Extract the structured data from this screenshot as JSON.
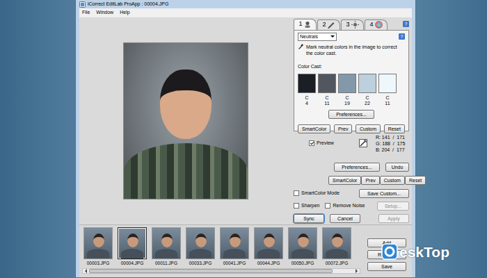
{
  "window": {
    "title": "iCorrect EditLab ProApp : 00004.JPG"
  },
  "menu": [
    {
      "label": "File"
    },
    {
      "label": "Window"
    },
    {
      "label": "Help"
    }
  ],
  "tabs": [
    {
      "label": "1",
      "selected": true
    },
    {
      "label": "2",
      "selected": false
    },
    {
      "label": "3",
      "selected": false
    },
    {
      "label": "4",
      "selected": false
    }
  ],
  "help_button": "?",
  "panel": {
    "mode": "Neutrals",
    "help": "?",
    "instruction": "Mark neutral colors in the image to correct the color cast.",
    "swatch_title": "Color Cast:",
    "swatches": [
      {
        "letter": "C",
        "value": "4",
        "color": "#1c1e26"
      },
      {
        "letter": "C",
        "value": "11",
        "color": "#52575f"
      },
      {
        "letter": "C",
        "value": "19",
        "color": "#8398a8"
      },
      {
        "letter": "C",
        "value": "22",
        "color": "#bcd0de"
      },
      {
        "letter": "C",
        "value": "11",
        "color": "#eef7fc"
      }
    ],
    "preferences": "Preferences...",
    "buttons": [
      "SmartColor",
      "Prev",
      "Custom",
      "Reset"
    ]
  },
  "preview": {
    "label": "Preview",
    "checked": true
  },
  "readings": [
    {
      "channel": "R:",
      "value": "141  /  171"
    },
    {
      "channel": "G:",
      "value": "188  /  175"
    },
    {
      "channel": "B:",
      "value": "204  /  177"
    }
  ],
  "preferences_button": "Preferences...",
  "undo_button": "Undo",
  "tool_buttons": [
    "SmartColor",
    "Prev",
    "Custom",
    "Reset"
  ],
  "smartcolor_mode": {
    "label": "SmartColor Mode",
    "checked": false
  },
  "save_custom": "Save Custom...",
  "options": [
    {
      "label": "Sharpen",
      "checked": false
    },
    {
      "label": "Remove Noise",
      "checked": false
    }
  ],
  "setup": {
    "label": "Setup...",
    "disabled": true
  },
  "actions": [
    {
      "label": "Sync",
      "disabled": false,
      "default": true
    },
    {
      "label": "Cancel",
      "disabled": false,
      "default": false
    },
    {
      "label": "Apply",
      "disabled": true,
      "default": false
    }
  ],
  "filmstrip": {
    "items": [
      {
        "label": "00003.JPG",
        "selected": false
      },
      {
        "label": "00004.JPG",
        "selected": true
      },
      {
        "label": "00011.JPG",
        "selected": false
      },
      {
        "label": "00033.JPG",
        "selected": false
      },
      {
        "label": "00041.JPG",
        "selected": false
      },
      {
        "label": "00044.JPG",
        "selected": false
      },
      {
        "label": "00050.JPG",
        "selected": false
      },
      {
        "label": "00072.JPG",
        "selected": false
      }
    ],
    "scrollbar": {
      "level": 0.92
    }
  },
  "side_buttons": [
    "Add",
    "Remove",
    "Save"
  ],
  "watermark": {
    "text": "eskTop"
  }
}
